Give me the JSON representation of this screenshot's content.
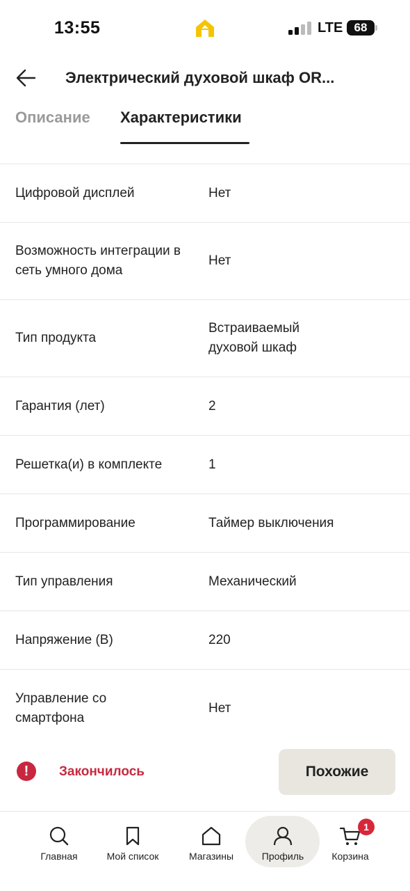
{
  "status_bar": {
    "time": "13:55",
    "network": "LTE",
    "battery": "68"
  },
  "header": {
    "title": "Электрический духовой шкаф OR...",
    "back_icon": "arrow-left-icon"
  },
  "tabs": [
    {
      "label": "Описание",
      "active": false
    },
    {
      "label": "Характеристики",
      "active": true
    }
  ],
  "specs": [
    {
      "name": "Цифровой дисплей",
      "value": "Нет"
    },
    {
      "name": "Возможность интеграции в сеть умного дома",
      "value": "Нет"
    },
    {
      "name": "Тип продукта",
      "value": "Встраиваемый духовой шкаф"
    },
    {
      "name": "Гарантия (лет)",
      "value": "2"
    },
    {
      "name": "Решетка(и) в комплекте",
      "value": "1"
    },
    {
      "name": "Программирование",
      "value": "Таймер выключения"
    },
    {
      "name": "Тип управления",
      "value": "Механический"
    },
    {
      "name": "Напряжение (В)",
      "value": "220"
    },
    {
      "name": "Управление со смартфона",
      "value": "Нет"
    }
  ],
  "action_bar": {
    "alert_icon": "exclamation-icon",
    "status": "Закончилось",
    "similar_label": "Похожие"
  },
  "bottom_nav": [
    {
      "label": "Главная",
      "icon": "search-icon",
      "active": false
    },
    {
      "label": "Мой список",
      "icon": "bookmark-icon",
      "active": false
    },
    {
      "label": "Магазины",
      "icon": "house-icon",
      "active": false
    },
    {
      "label": "Профиль",
      "icon": "person-icon",
      "active": true
    },
    {
      "label": "Корзина",
      "icon": "cart-icon",
      "active": false,
      "badge": "1"
    }
  ],
  "colors": {
    "accent_red": "#c8283f",
    "button_bg": "#e8e6df",
    "inactive_tab": "#9a9a9a"
  }
}
